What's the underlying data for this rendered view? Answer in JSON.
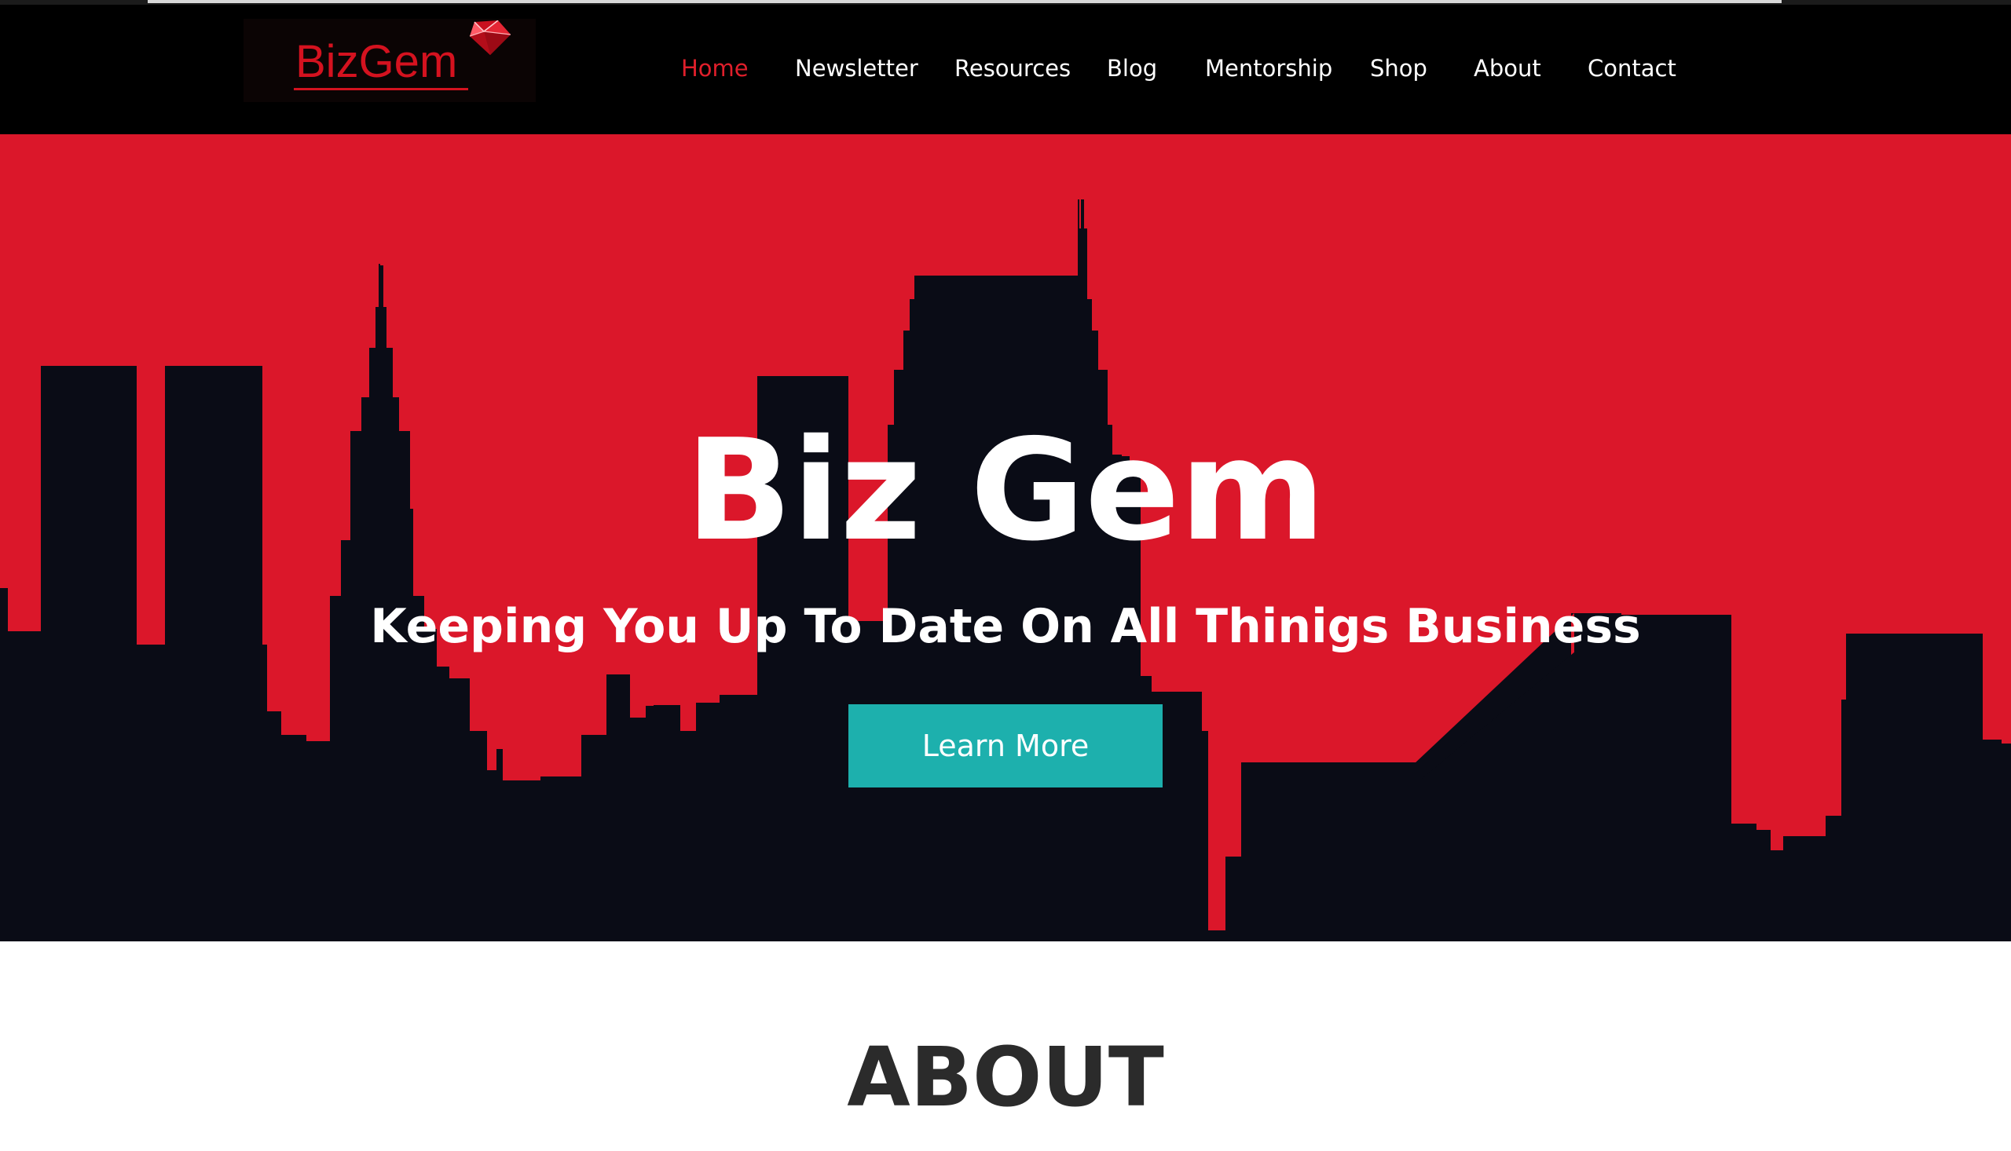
{
  "logo": {
    "text": "BizGem",
    "icon": "ruby-gem-icon"
  },
  "nav": {
    "items": [
      {
        "label": "Home",
        "active": true
      },
      {
        "label": "Newsletter",
        "active": false
      },
      {
        "label": "Resources",
        "active": false
      },
      {
        "label": "Blog",
        "active": false
      },
      {
        "label": "Mentorship",
        "active": false
      },
      {
        "label": "Shop",
        "active": false
      },
      {
        "label": "About",
        "active": false
      },
      {
        "label": "Contact",
        "active": false
      }
    ]
  },
  "hero": {
    "title": "Biz Gem",
    "subtitle": "Keeping You Up To Date On All Thinigs Business",
    "cta_label": "Learn More"
  },
  "about": {
    "heading": "ABOUT"
  },
  "colors": {
    "brand_red": "#db172a",
    "header_bg": "#000000",
    "skyline": "#0a0c16",
    "cta_teal": "#1db0ad",
    "active_nav": "#e01f2b"
  }
}
